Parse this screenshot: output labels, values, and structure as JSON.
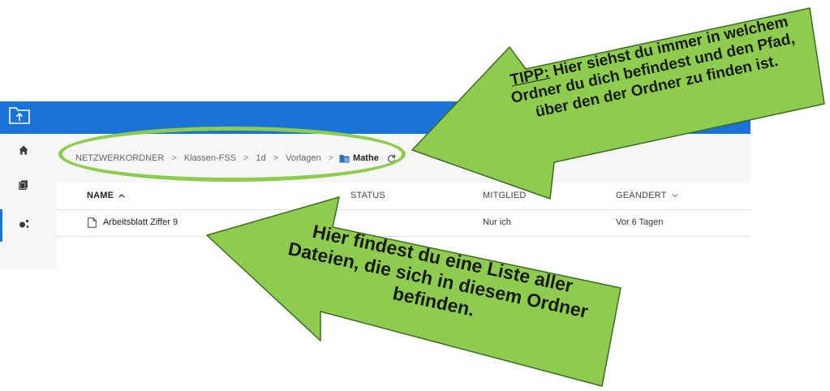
{
  "breadcrumb": {
    "items": [
      "NETZWERKORDNER",
      "Klassen-FSS",
      "1d",
      "Vorlagen"
    ],
    "current": "Mathe",
    "separator": ">"
  },
  "table": {
    "columns": {
      "name": "NAME",
      "status": "STATUS",
      "member": "MITGLIED",
      "changed": "GEÄNDERT"
    },
    "rows": [
      {
        "name": "Arbeitsblatt Ziffer 9",
        "member": "Nur ich",
        "changed": "Vor 6 Tagen"
      }
    ]
  },
  "annotations": {
    "tip_label": "TIPP:",
    "tip_text": "Hier siehst du immer in welchem Ordner du dich befindest und den Pfad, über den der Ordner zu finden ist.",
    "list_text": "Hier findest du eine Liste aller Dateien, die sich in diesem Ordner befinden."
  },
  "colors": {
    "accent": "#1a73d6",
    "annotation_green": "#8ecc4f",
    "annotation_border": "#3e6b24"
  },
  "icons": {
    "app": "folder-upload-icon",
    "rail": [
      "home-icon",
      "files-icon",
      "share-icon"
    ],
    "breadcrumb": "folder-icon",
    "refresh": "refresh-icon",
    "file": "file-icon"
  }
}
